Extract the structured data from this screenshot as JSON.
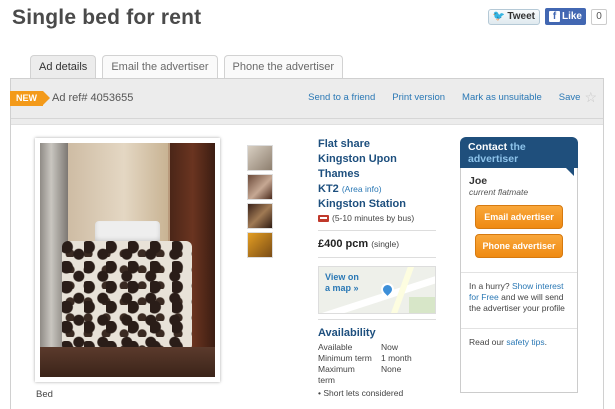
{
  "page_title": "Single bed for rent",
  "social": {
    "tweet_label": "Tweet",
    "like_label": "Like",
    "like_count": "0"
  },
  "tabs": [
    {
      "label": "Ad details",
      "active": true
    },
    {
      "label": "Email the advertiser",
      "active": false
    },
    {
      "label": "Phone the advertiser",
      "active": false
    }
  ],
  "ad_bar": {
    "badge": "NEW",
    "ad_ref": "Ad ref# 4053655",
    "actions": [
      "Send to a friend",
      "Print version",
      "Mark as unsuitable",
      "Save"
    ]
  },
  "photo": {
    "caption": "Bed",
    "thumbnail_count": 4
  },
  "details": {
    "type": "Flat share",
    "area_line1": "Kingston Upon",
    "area_line2": "Thames",
    "postcode": "KT2",
    "area_info": "(Area info)",
    "station": "Kingston Station",
    "station_distance": "(5-10 minutes by bus)",
    "price": "£400 pcm",
    "price_note": "(single)",
    "map_link_line1": "View on",
    "map_link_line2": "a map »"
  },
  "availability": {
    "title": "Availability",
    "rows": [
      {
        "key": "Available",
        "value": "Now"
      },
      {
        "key": "Minimum term",
        "value": "1 month"
      },
      {
        "key": "Maximum",
        "value": "None"
      },
      {
        "key": "term",
        "value": ""
      }
    ],
    "note": "• Short lets considered"
  },
  "contact": {
    "head_part1": "Contact",
    "head_part2": "the",
    "head_part3": "advertiser",
    "name": "Joe",
    "role": "current flatmate",
    "email_button": "Email advertiser",
    "phone_button": "Phone advertiser",
    "hurry_prefix": "In a hurry?",
    "hurry_link": "Show interest for Free",
    "hurry_suffix": "and we will send the advertiser your profile",
    "safety_prefix": "Read our",
    "safety_link": "safety tips",
    "safety_suffix": "."
  },
  "colors": {
    "accent_blue": "#1f4f7c",
    "link_blue": "#2a78b5",
    "orange": "#f39a1a"
  }
}
